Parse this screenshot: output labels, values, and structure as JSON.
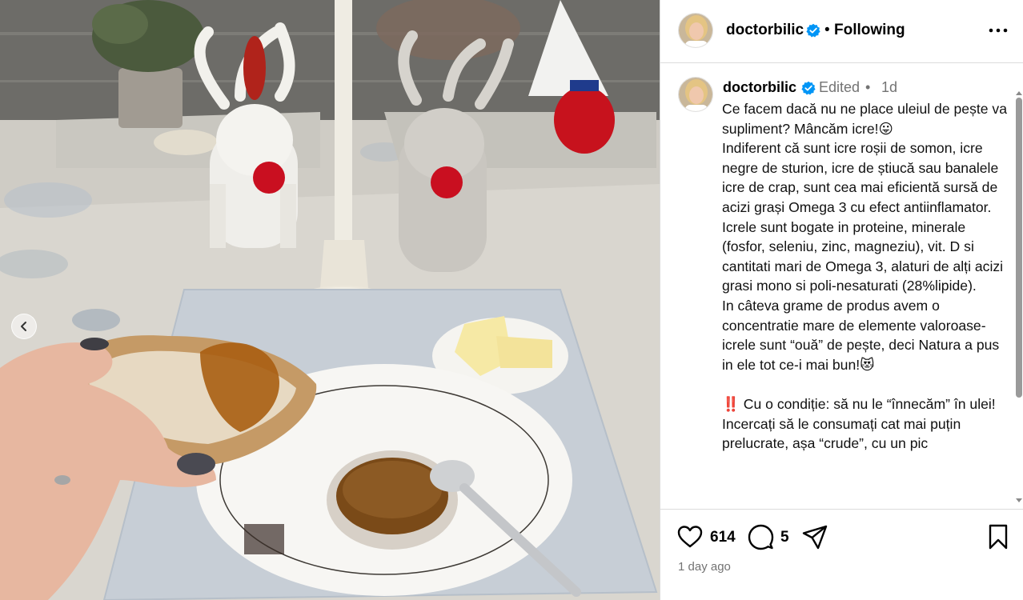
{
  "post": {
    "username": "doctorbilic",
    "verified": true,
    "follow_status": "Following",
    "dot": "•"
  },
  "caption": {
    "username": "doctorbilic",
    "edited_label": "Edited",
    "dot": "•",
    "time_short": "1d",
    "text": "Ce facem dacă nu ne place uleiul de pește va supliment? Mâncăm icre!😛\nIndiferent că sunt icre roșii de somon, icre negre de sturion, icre de știucă sau banalele icre de crap, sunt cea mai eficientă sursă de acizi grași Omega 3 cu efect antiinflamator.\nIcrele sunt bogate in proteine, minerale (fosfor, seleniu, zinc, magneziu), vit. D si cantitati mari de Omega 3, alaturi de alți acizi grasi mono si poli-nesaturati (28%lipide).\nIn câteva grame de produs avem o concentratie mare de elemente valoroase- icrele sunt “ouă” de pește, deci Natura a pus in ele tot ce-i mai bun!😻\n\n‼️ Cu o condiție: să nu le “înnecăm” în ulei! Incercați să le consumați cat mai puțin prelucrate, așa “crude”, cu un pic"
  },
  "actions": {
    "likes": "614",
    "comments": "5",
    "posted_ago": "1 day ago"
  },
  "icons": {
    "verified": "verified-badge-icon",
    "more": "more-options-icon",
    "like": "heart-icon",
    "comment": "comment-bubble-icon",
    "share": "paper-plane-icon",
    "save": "bookmark-icon",
    "prev": "chevron-left-icon"
  },
  "colors": {
    "verified_blue": "#0095f6",
    "muted_text": "#737373",
    "border": "#dbdbdb"
  }
}
